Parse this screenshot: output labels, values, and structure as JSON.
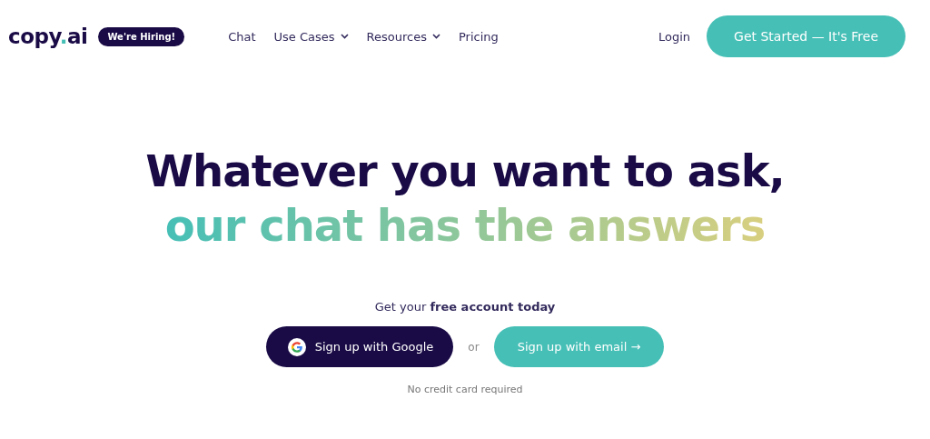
{
  "logo": {
    "parts": [
      {
        "text": "copy",
        "accent": false
      },
      {
        "text": ".",
        "accent": true
      },
      {
        "text": "ai",
        "accent": false
      }
    ]
  },
  "hiring_badge": "We're Hiring!",
  "nav": [
    {
      "label": "Chat",
      "dropdown": false
    },
    {
      "label": "Use Cases",
      "dropdown": true
    },
    {
      "label": "Resources",
      "dropdown": true
    },
    {
      "label": "Pricing",
      "dropdown": false
    }
  ],
  "login": "Login",
  "cta": "Get Started — It's Free",
  "headline": [
    "Whatever you want to ask,",
    "our chat has the answers"
  ],
  "subtitle": "Get your **free account today**",
  "google_button": "Sign up with Google",
  "or": "or",
  "email_button": "Sign up with email →",
  "note": "No credit card required"
}
